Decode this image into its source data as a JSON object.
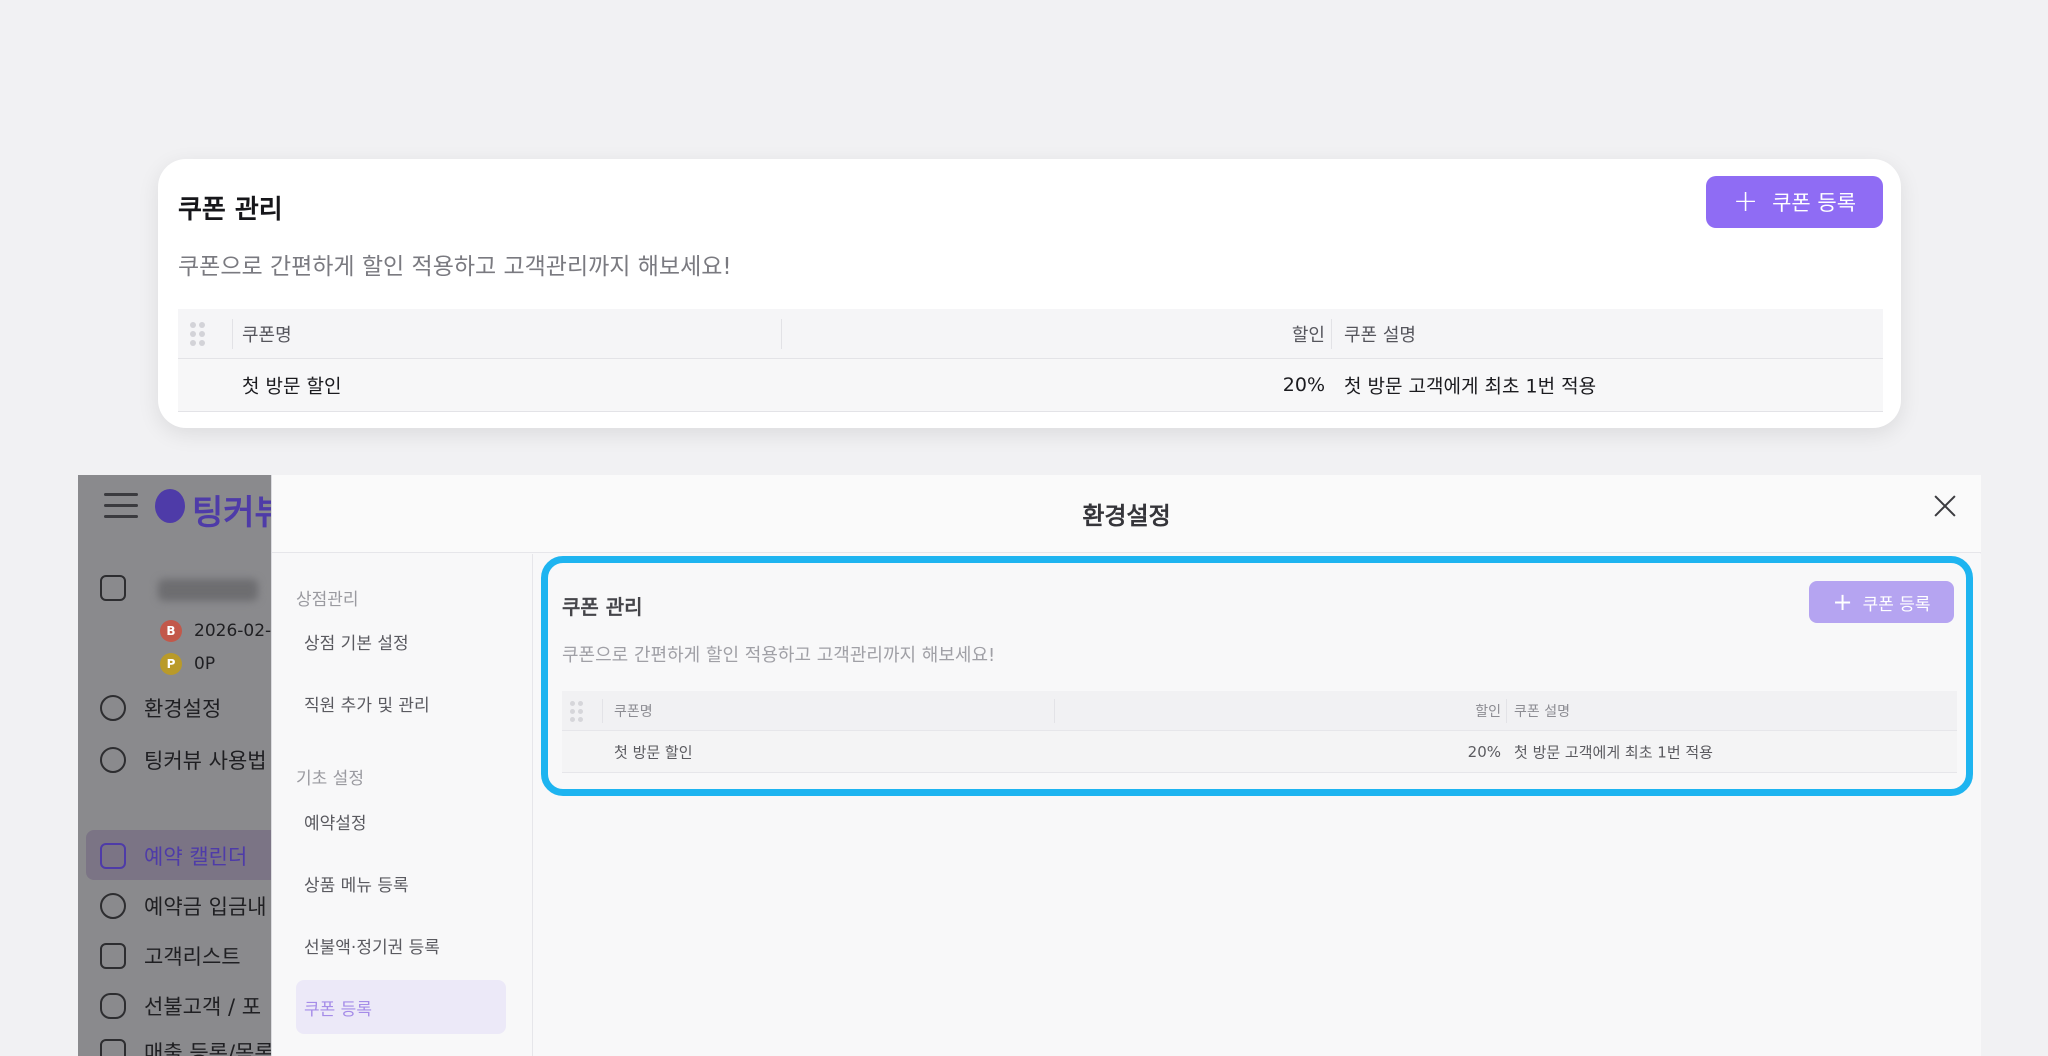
{
  "zoom_card": {
    "title": "쿠폰 관리",
    "subtitle": "쿠폰으로 간편하게 할인 적용하고 고객관리까지 해보세요!",
    "register_button": "쿠폰 등록",
    "table": {
      "headers": {
        "name": "쿠폰명",
        "discount": "할인",
        "description": "쿠폰 설명"
      },
      "rows": [
        {
          "name": "첫 방문 할인",
          "discount": "20%",
          "description": "첫 방문 고객에게 최초 1번 적용"
        }
      ]
    }
  },
  "app": {
    "logo": "팅커뷰",
    "shop_name": "",
    "date": "2026-02-",
    "points": "0P",
    "badge_b": "B",
    "badge_p": "P",
    "sidebar": [
      "환경설정",
      "팅커뷰 사용법",
      "예약 캘린더",
      "예약금 입금내",
      "고객리스트",
      "선불고객 / 포",
      "매출 등록/목록"
    ]
  },
  "modal": {
    "title": "환경설정",
    "nav": {
      "section1": "상점관리",
      "items1": [
        "상점 기본 설정",
        "직원 추가 및 관리"
      ],
      "section2": "기초 설정",
      "items2": [
        "예약설정",
        "상품 메뉴 등록",
        "선불액·정기권 등록",
        "쿠폰 등록"
      ]
    },
    "panel": {
      "title": "쿠폰 관리",
      "subtitle": "쿠폰으로 간편하게 할인 적용하고 고객관리까지 해보세요!",
      "register_button": "쿠폰 등록",
      "headers": {
        "name": "쿠폰명",
        "discount": "할인",
        "description": "쿠폰 설명"
      },
      "rows": [
        {
          "name": "첫 방문 할인",
          "discount": "20%",
          "description": "첫 방문 고객에게 최초 1번 적용"
        }
      ]
    }
  },
  "colors": {
    "accent": "#8f6cf4",
    "highlight": "#1eb4f0"
  }
}
